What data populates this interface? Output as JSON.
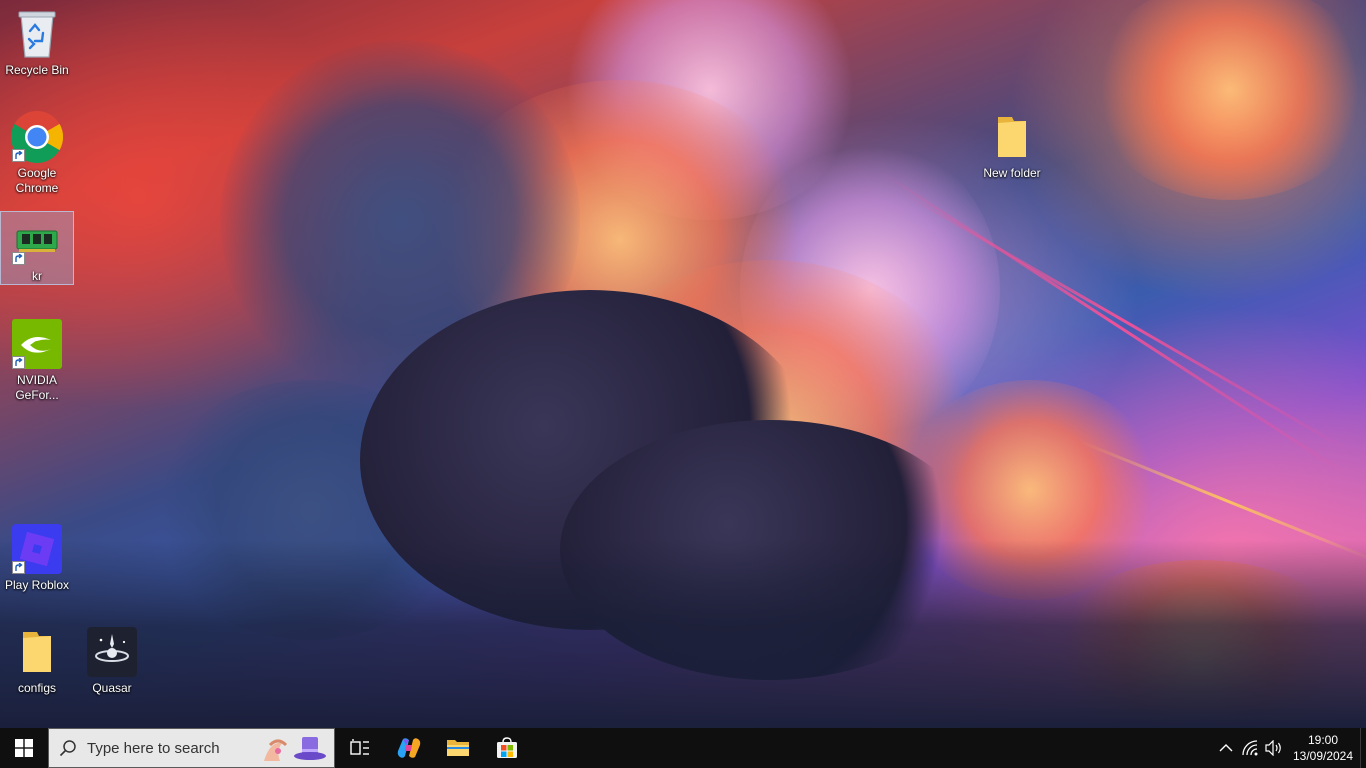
{
  "desktop": {
    "icons": [
      {
        "label": "Recycle Bin"
      },
      {
        "label": "Google Chrome"
      },
      {
        "label": "kr"
      },
      {
        "label": "NVIDIA GeFor..."
      },
      {
        "label": "Play Roblox"
      },
      {
        "label": "configs"
      },
      {
        "label": "Quasar"
      },
      {
        "label": "New folder"
      }
    ],
    "selected_icon": "kr"
  },
  "taskbar": {
    "search": {
      "placeholder": "Type here to search"
    },
    "pinned": [
      "Task View",
      "Copilot",
      "File Explorer",
      "Microsoft Store"
    ],
    "clock": {
      "time": "19:00",
      "date": "13/09/2024"
    }
  },
  "colors": {
    "taskbar_bg": "#0f0f10",
    "search_bg": "#e8e8e8",
    "windows_blue": "#0078d7"
  }
}
